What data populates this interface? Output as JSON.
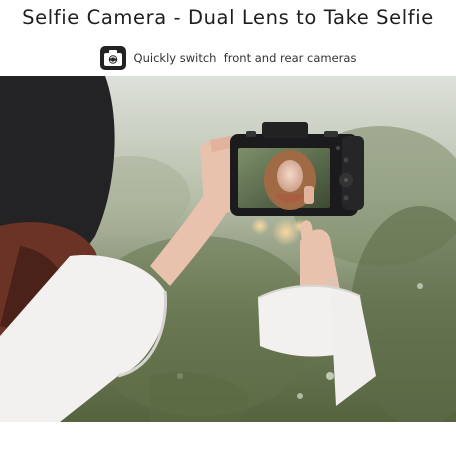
{
  "headline": "Selfie Camera - Dual Lens to Take Selfie",
  "feature": {
    "icon": "camera-switch-icon",
    "text": "Quickly switch  front and rear cameras"
  },
  "photo": {
    "subject": "woman-holding-camera",
    "colors": {
      "bokeh_green": "#6f7d5a",
      "sky": "#dfe3dd",
      "sleeve": "#f2f1ef",
      "skin": "#e9c2ad",
      "hair": "#5a2e22",
      "camera": "#1b1b1d"
    }
  }
}
